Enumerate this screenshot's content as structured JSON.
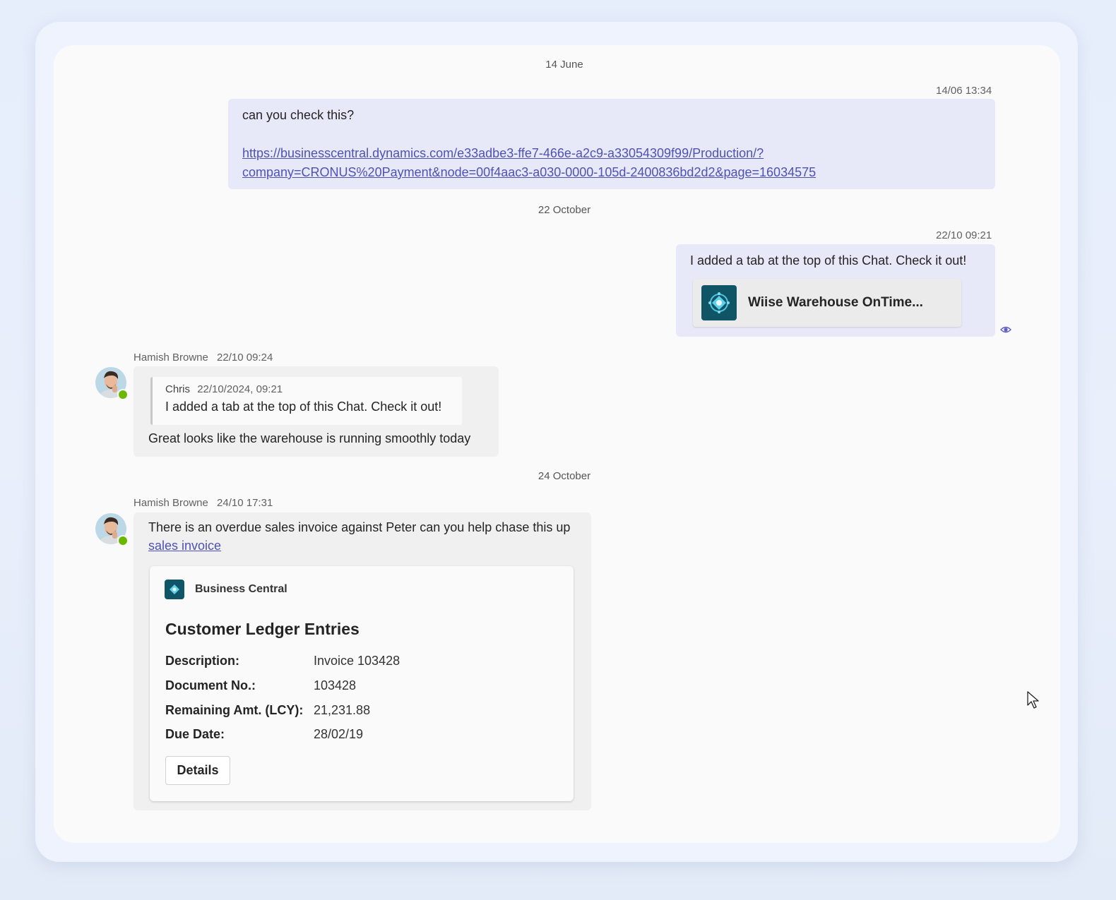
{
  "dates": {
    "first": "14 June",
    "second": "22 October",
    "third": "24 October"
  },
  "messages": {
    "m1": {
      "timestamp": "14/06 13:34",
      "text": "can you check this?",
      "link_line1": "https://businesscentral.dynamics.com/e33adbe3-ffe7-466e-a2c9-a33054309f99/Production/?",
      "link_line2": "company=CRONUS%20Payment&node=00f4aac3-a030-0000-105d-2400836bd2d2&page=16034575"
    },
    "m2": {
      "timestamp": "22/10 09:21",
      "text": "I added a tab at the top of this Chat. Check it out!",
      "tab_title": "Wiise Warehouse OnTime..."
    },
    "m3": {
      "sender": "Hamish Browne",
      "timestamp": "22/10 09:24",
      "quote_author": "Chris",
      "quote_time": "22/10/2024, 09:21",
      "quote_text": "I added a tab at the top of this Chat. Check it out!",
      "text": "Great looks like the warehouse is running smoothly today"
    },
    "m4": {
      "sender": "Hamish Browne",
      "timestamp": "24/10 17:31",
      "text": "There is an overdue sales invoice against Peter can you help chase this up",
      "link": "sales invoice",
      "card": {
        "app_name": "Business Central",
        "title": "Customer Ledger Entries",
        "fields": [
          {
            "label": "Description:",
            "value": "Invoice 103428"
          },
          {
            "label": "Document No.:",
            "value": "103428"
          },
          {
            "label": "Remaining Amt. (LCY):",
            "value": "21,231.88"
          },
          {
            "label": "Due Date:",
            "value": "28/02/19"
          }
        ],
        "button": "Details"
      }
    }
  },
  "colors": {
    "accent": "#4f52b2",
    "my_bubble": "#e7e9f8",
    "their_bubble": "#f0f0f0",
    "presence": "#6bb700",
    "app_icon": "#0f5566"
  },
  "icons": {
    "seen": "eye-icon",
    "app": "business-central-icon",
    "cursor": "mouse-pointer-icon"
  }
}
